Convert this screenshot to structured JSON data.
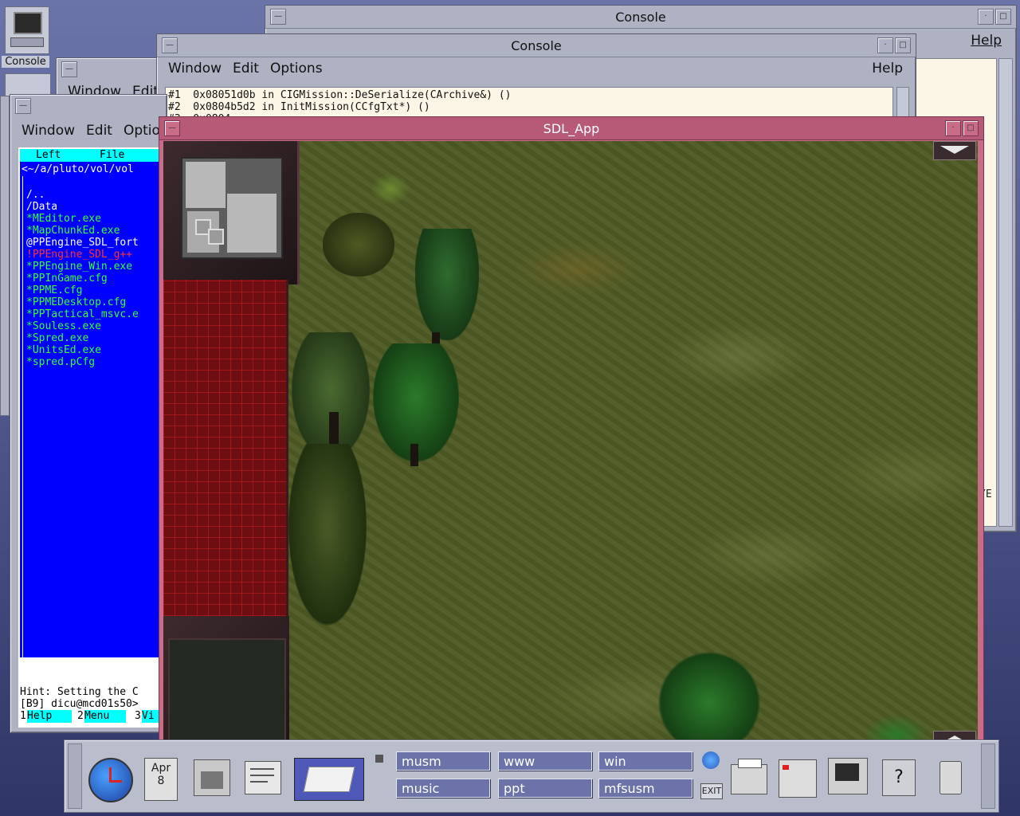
{
  "desktop": {
    "console_icon_label": "Console"
  },
  "back_console": {
    "title": "Console",
    "help": "Help",
    "edge_text": "YE"
  },
  "mid_window": {
    "menu": [
      "Window",
      "Edit"
    ]
  },
  "console": {
    "title": "Console",
    "menu": [
      "Window",
      "Edit",
      "Options"
    ],
    "help": "Help",
    "lines": [
      "#1  0x08051d0b in CIGMission::DeSerialize(CArchive&) ()",
      "#2  0x0804b5d2 in InitMission(CCfgTxt*) ()",
      "#3  0x0804..."
    ]
  },
  "file_manager": {
    "menu": [
      "Window",
      "Edit",
      "Optio"
    ],
    "panel_headers": [
      "Left",
      "File"
    ],
    "path": "<~/a/pluto/vol/vol",
    "files": [
      {
        "name": "/..",
        "color": "#ffffff"
      },
      {
        "name": "/Data",
        "color": "#ffffff"
      },
      {
        "name": "*MEditor.exe",
        "color": "#33ff33"
      },
      {
        "name": "*MapChunkEd.exe",
        "color": "#33ff33"
      },
      {
        "name": "@PPEngine_SDL_fort",
        "color": "#ffffff"
      },
      {
        "name": "!PPEngine_SDL_g++",
        "color": "#ff3030"
      },
      {
        "name": "*PPEngine_Win.exe",
        "color": "#33ff33"
      },
      {
        "name": "*PPInGame.cfg",
        "color": "#33ff33"
      },
      {
        "name": "*PPME.cfg",
        "color": "#33ff33"
      },
      {
        "name": "*PPMEDesktop.cfg",
        "color": "#33ff33"
      },
      {
        "name": "*PPTactical_msvc.e",
        "color": "#33ff33"
      },
      {
        "name": "*Souless.exe",
        "color": "#33ff33"
      },
      {
        "name": "*Spred.exe",
        "color": "#33ff33"
      },
      {
        "name": "*UnitsEd.exe",
        "color": "#33ff33"
      },
      {
        "name": "*spred.pCfg",
        "color": "#33ff33"
      }
    ],
    "selected_file": "*spred.pCfg",
    "hint": "Hint: Setting the C",
    "prompt": "[B9] dicu@mcd01s50>",
    "fkeys": [
      {
        "num": "1",
        "label": "Help"
      },
      {
        "num": "2",
        "label": "Menu"
      },
      {
        "num": "3",
        "label": "Vi"
      }
    ]
  },
  "sdl_app": {
    "title": "SDL_App"
  },
  "taskbar": {
    "date_month": "Apr",
    "date_day": "8",
    "workspaces": [
      "musm",
      "www",
      "win",
      "music",
      "ppt",
      "mfsusm"
    ],
    "exit_label": "EXIT",
    "help_icon_glyph": "?"
  }
}
